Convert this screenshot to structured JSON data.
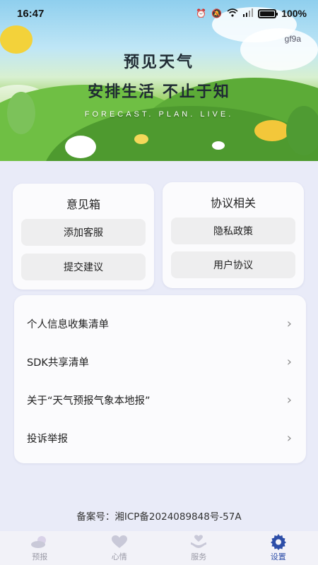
{
  "status_bar": {
    "time": "16:47",
    "battery": "100%",
    "icons": [
      "alarm-icon",
      "mute-icon",
      "wifi-icon",
      "signal-icon",
      "battery-icon"
    ]
  },
  "banner": {
    "watermark": "gf9a",
    "title_line1": "预见天气",
    "title_line2": "安排生活 不止于知",
    "subtitle": "FORECAST. PLAN. LIVE."
  },
  "feedback_card": {
    "title": "意见箱",
    "buttons": [
      "添加客服",
      "提交建议"
    ]
  },
  "agreement_card": {
    "title": "协议相关",
    "buttons": [
      "隐私政策",
      "用户协议"
    ]
  },
  "list": {
    "items": [
      {
        "label": "个人信息收集清单"
      },
      {
        "label": "SDK共享清单"
      },
      {
        "label": "关于“天气预报气象本地报”"
      },
      {
        "label": "投诉举报"
      }
    ]
  },
  "footer": {
    "beian": "备案号：湘ICP备2024089848号-57A"
  },
  "tabbar": {
    "active_color": "#2d4ea8",
    "inactive_color": "#c9c9d8",
    "tabs": [
      {
        "label": "预报",
        "icon": "weather-icon",
        "active": false
      },
      {
        "label": "心情",
        "icon": "heart-icon",
        "active": false
      },
      {
        "label": "服务",
        "icon": "service-icon",
        "active": false
      },
      {
        "label": "设置",
        "icon": "gear-icon",
        "active": true
      }
    ]
  }
}
